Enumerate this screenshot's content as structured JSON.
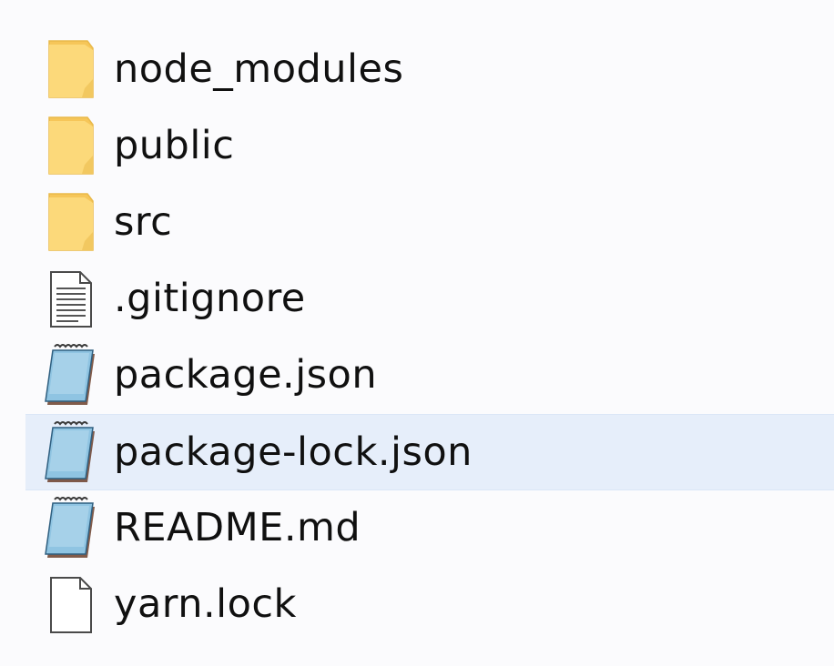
{
  "files": [
    {
      "name": "node_modules",
      "icon": "folder-icon"
    },
    {
      "name": "public",
      "icon": "folder-icon"
    },
    {
      "name": "src",
      "icon": "folder-icon"
    },
    {
      "name": ".gitignore",
      "icon": "text-document-icon"
    },
    {
      "name": "package.json",
      "icon": "notepad-document-icon"
    },
    {
      "name": "package-lock.json",
      "icon": "notepad-document-icon",
      "selected": true
    },
    {
      "name": "README.md",
      "icon": "notepad-document-icon"
    },
    {
      "name": "yarn.lock",
      "icon": "blank-document-icon"
    }
  ],
  "colors": {
    "folder_fill": "#fcd97a",
    "folder_edge": "#e9b94a",
    "notepad_fill": "#8fc4e2",
    "selection_bg": "#e6eefa"
  }
}
